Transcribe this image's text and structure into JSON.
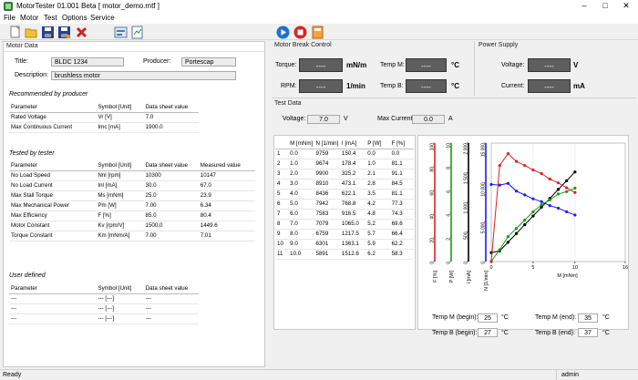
{
  "app": {
    "title": "MotorTester 01.001 Beta   [ motor_demo.mtf ]"
  },
  "menu": [
    "File",
    "Motor",
    "Test",
    "Options",
    "Service"
  ],
  "toolbar": {
    "icons": [
      "new-file-icon",
      "open-folder-icon",
      "save-icon",
      "save-as-icon",
      "delete-icon",
      "motor-properties-icon",
      "report-icon",
      "play-icon",
      "stop-icon",
      "calculator-icon"
    ]
  },
  "motor_data": {
    "header": "Motor Data",
    "title_label": "Title:",
    "title_value": "BLDC 1234",
    "producer_label": "Producer:",
    "producer_value": "Portescap",
    "description_label": "Description:",
    "description_value": "brushless motor"
  },
  "producer_table": {
    "header": "Recommended by producer",
    "columns": [
      "Parameter",
      "Symbol [Unit]",
      "Data sheet value"
    ],
    "rows": [
      [
        "Rated Voltage",
        "Vr [V]",
        "7.0"
      ],
      [
        "Max Continuous Current",
        "Imc [mA]",
        "1900.0"
      ]
    ]
  },
  "tester_table": {
    "header": "Tested by tester",
    "columns": [
      "Parameter",
      "Symbol [Unit]",
      "Data sheet value",
      "Measured value"
    ],
    "rows": [
      [
        "No Load Speed",
        "Nnl [rpm]",
        "10300",
        "10147"
      ],
      [
        "No Load Current",
        "Inl [mA]",
        "30.0",
        "67.0"
      ],
      [
        "Max Stall Torque",
        "Ms [mNm]",
        "25.0",
        "23.9"
      ],
      [
        "Max Mechanical Power",
        "Pm [W]",
        "7.00",
        "6.34"
      ],
      [
        "Max Efficiency",
        "F [%]",
        "85.0",
        "80.4"
      ],
      [
        "Motor Constant",
        "Kv [rpm/V]",
        "1500.0",
        "1449.6"
      ],
      [
        "Torque Constant",
        "Km [mNm/A]",
        "7.00",
        "7.01"
      ]
    ]
  },
  "user_table": {
    "header": "User defined",
    "columns": [
      "Parameter",
      "Symbol [Unit]",
      "Data sheet value"
    ],
    "rows": [
      [
        "---",
        "--- [---]",
        "---"
      ],
      [
        "---",
        "--- [---]",
        "---"
      ],
      [
        "---",
        "--- [---]",
        "---"
      ]
    ]
  },
  "break_control": {
    "header": "Motor Break Control",
    "torque_label": "Torque:",
    "torque_value": "----",
    "torque_unit": "mN/m",
    "rpm_label": "RPM:",
    "rpm_value": "----",
    "rpm_unit": "1/min",
    "tempm_label": "Temp M:",
    "tempm_value": "----",
    "tempm_unit": "°C",
    "tempb_label": "Temp B:",
    "tempb_value": "----",
    "tempb_unit": "°C"
  },
  "power_supply": {
    "header": "Power Supply",
    "voltage_label": "Voltage:",
    "voltage_value": "----",
    "voltage_unit": "V",
    "current_label": "Current:",
    "current_value": "----",
    "current_unit": "mA"
  },
  "test_data": {
    "header": "Test Data",
    "voltage_label": "Voltage:",
    "voltage_value": "7.0",
    "voltage_unit": "V",
    "maxcurrent_label": "Max Current:",
    "maxcurrent_value": "0.0",
    "maxcurrent_unit": "A",
    "columns": [
      "",
      "M [mNm]",
      "N [1/min]",
      "I [mA]",
      "P [W]",
      "F [%]"
    ],
    "rows": [
      [
        "1",
        "0.0",
        "9759",
        "150.4",
        "0.0",
        "0.0"
      ],
      [
        "2",
        "1.0",
        "9674",
        "178.4",
        "1.0",
        "81.1"
      ],
      [
        "3",
        "2.0",
        "9900",
        "325.2",
        "2.1",
        "91.1"
      ],
      [
        "4",
        "3.0",
        "8910",
        "473.1",
        "2.8",
        "84.5"
      ],
      [
        "5",
        "4.0",
        "8436",
        "622.1",
        "3.5",
        "81.1"
      ],
      [
        "6",
        "5.0",
        "7942",
        "768.8",
        "4.2",
        "77.3"
      ],
      [
        "7",
        "6.0",
        "7583",
        "916.5",
        "4.8",
        "74.3"
      ],
      [
        "8",
        "7.0",
        "7079",
        "1065.0",
        "5.2",
        "69.6"
      ],
      [
        "9",
        "8.0",
        "6759",
        "1217.5",
        "5.7",
        "66.4"
      ],
      [
        "10",
        "9.0",
        "6301",
        "1363.1",
        "5.9",
        "62.2"
      ],
      [
        "11",
        "10.0",
        "5891",
        "1512.6",
        "6.2",
        "58.3"
      ]
    ]
  },
  "temps": {
    "tmb_label": "Temp M (begin):",
    "tmb_value": "25",
    "tmb_unit": "°C",
    "tme_label": "Temp M (end):",
    "tme_value": "35",
    "tme_unit": "°C",
    "tbb_label": "Temp B (begin):",
    "tbb_value": "27",
    "tbb_unit": "°C",
    "tbe_label": "Temp B (end):",
    "tbe_value": "37",
    "tbe_unit": "°C"
  },
  "status": {
    "left": "Ready",
    "user": "admin"
  },
  "chart_data": {
    "type": "line",
    "xlabel": "M [mNm]",
    "x_ticks": [
      "0",
      "5",
      "10",
      "16"
    ],
    "xlim": [
      0,
      16
    ],
    "axes": [
      {
        "label": "F [%]",
        "color": "#e02020",
        "ticks": [
          "0",
          "20",
          "40",
          "60",
          "80",
          "100"
        ]
      },
      {
        "label": "P [W]",
        "color": "#1a9a1a",
        "ticks": [
          "0",
          "2",
          "4",
          "6",
          "8",
          "10"
        ]
      },
      {
        "label": "I [mA]",
        "color": "#000000",
        "ticks": [
          "0",
          "500",
          "1 000",
          "1 500",
          "2 000"
        ]
      },
      {
        "label": "N [1/min]",
        "color": "#1a1aff",
        "ticks": [
          "0",
          "5 000",
          "10 000",
          "15 000"
        ]
      }
    ],
    "series": [
      {
        "axis": 3,
        "color": "#1a1aff",
        "values": [
          9759,
          9674,
          9900,
          8910,
          8436,
          7942,
          7583,
          7079,
          6759,
          6301,
          5891
        ]
      },
      {
        "axis": 2,
        "color": "#000000",
        "values": [
          150.4,
          178.4,
          325.2,
          473.1,
          622.1,
          768.8,
          916.5,
          1065.0,
          1217.5,
          1363.1,
          1512.6
        ]
      },
      {
        "axis": 1,
        "color": "#1a9a1a",
        "values": [
          0.0,
          1.0,
          2.1,
          2.8,
          3.5,
          4.2,
          4.8,
          5.2,
          5.7,
          5.9,
          6.2
        ]
      },
      {
        "axis": 0,
        "color": "#e02020",
        "values": [
          0.0,
          81.1,
          91.1,
          84.5,
          81.1,
          77.3,
          74.3,
          69.6,
          66.4,
          62.2,
          58.3
        ]
      }
    ],
    "x": [
      0,
      1,
      2,
      3,
      4,
      5,
      6,
      7,
      8,
      9,
      10
    ]
  }
}
